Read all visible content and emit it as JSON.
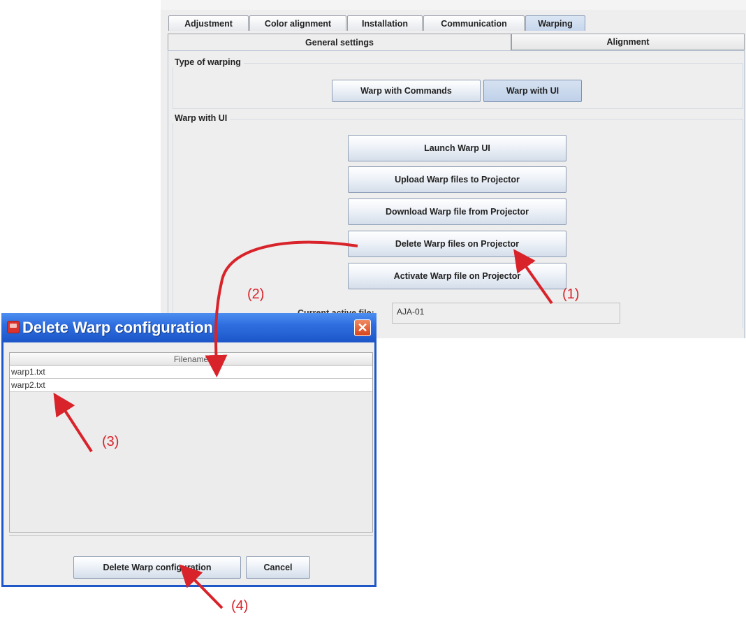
{
  "tabs": [
    "Adjustment",
    "Color alignment",
    "Installation",
    "Communication",
    "Warping"
  ],
  "active_tab": "Warping",
  "subtabs": [
    "General settings",
    "Alignment"
  ],
  "type_of_warping": {
    "title": "Type of warping",
    "commands_label": "Warp with Commands",
    "ui_label": "Warp with UI"
  },
  "warp_ui": {
    "title": "Warp with UI",
    "buttons": [
      "Launch Warp UI",
      "Upload Warp files to Projector",
      "Download Warp file from Projector",
      "Delete Warp files on Projector",
      "Activate Warp file on Projector"
    ],
    "current_field": {
      "label": "Current active file:",
      "value": "AJA-01"
    }
  },
  "dialog": {
    "title": "Delete Warp configuration",
    "column_header": "Filename",
    "files": [
      "warp1.txt",
      "warp2.txt"
    ],
    "delete_label": "Delete Warp configuration",
    "cancel_label": "Cancel",
    "close_glyph": "✕"
  },
  "annotations": {
    "step1": "(1)",
    "step2": "(2)",
    "step3": "(3)",
    "step4": "(4)",
    "color": "#d8232a"
  }
}
